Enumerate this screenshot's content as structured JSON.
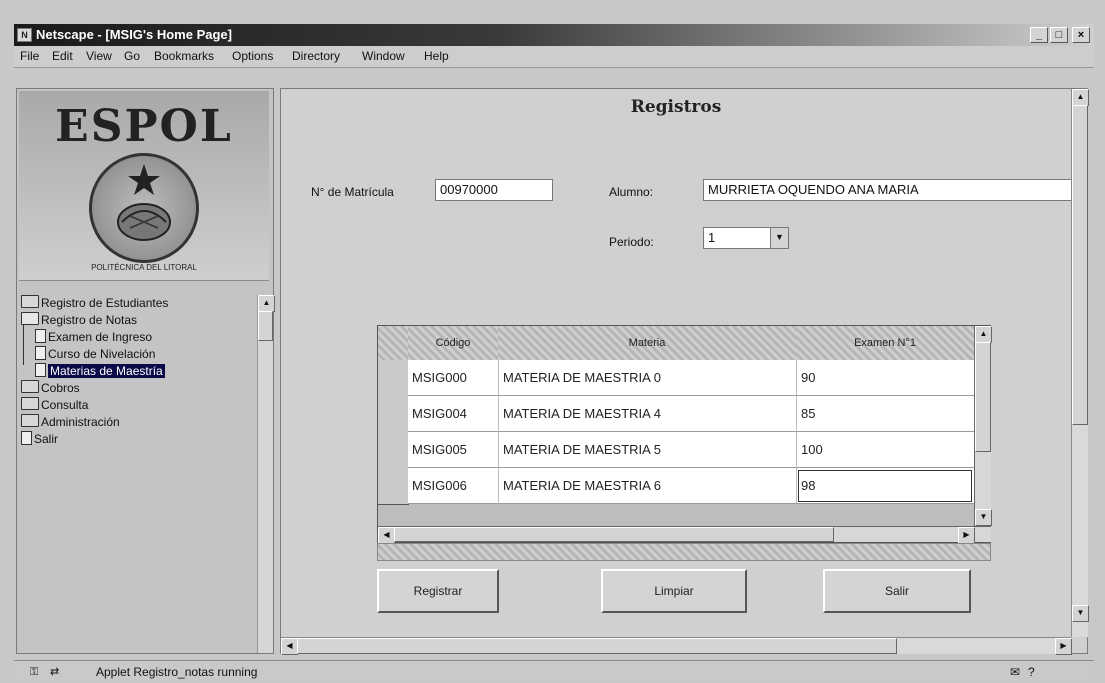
{
  "window": {
    "title": "Netscape - [MSIG's Home Page]",
    "controls": [
      "_",
      "□",
      "×"
    ]
  },
  "menu": [
    "File",
    "Edit",
    "View",
    "Go",
    "Bookmarks",
    "Options",
    "Directory",
    "Window",
    "Help"
  ],
  "logo": {
    "text": "ESPOL",
    "caption": "POLITÉCNICA DEL LITORAL"
  },
  "tree": [
    {
      "label": "Registro de Estudiantes",
      "type": "folder",
      "level": 0
    },
    {
      "label": "Registro de Notas",
      "type": "folder-open",
      "level": 0
    },
    {
      "label": "Examen de Ingreso",
      "type": "doc",
      "level": 1
    },
    {
      "label": "Curso de Nivelación",
      "type": "doc",
      "level": 1
    },
    {
      "label": "Materias de Maestría",
      "type": "doc",
      "level": 1,
      "selected": true
    },
    {
      "label": "Cobros",
      "type": "folder",
      "level": 0
    },
    {
      "label": "Consulta",
      "type": "folder",
      "level": 0
    },
    {
      "label": "Administración",
      "type": "folder",
      "level": 0
    },
    {
      "label": "Salir",
      "type": "doc",
      "level": 0
    }
  ],
  "page": {
    "title": "Registros",
    "matricula_label": "N° de Matrícula",
    "matricula_value": "00970000",
    "alumno_label": "Alumno:",
    "alumno_value": "MURRIETA OQUENDO ANA MARIA",
    "periodo_label": "Periodo:",
    "periodo_value": "1"
  },
  "table": {
    "columns": [
      "Código",
      "Materia",
      "Examen N°1"
    ],
    "rows": [
      {
        "codigo": "MSIG000",
        "materia": "MATERIA DE MAESTRIA 0",
        "nota": "90"
      },
      {
        "codigo": "MSIG004",
        "materia": "MATERIA DE MAESTRIA 4",
        "nota": "85"
      },
      {
        "codigo": "MSIG005",
        "materia": "MATERIA DE MAESTRIA 5",
        "nota": "100"
      },
      {
        "codigo": "MSIG006",
        "materia": "MATERIA DE MAESTRIA 6",
        "nota": "98"
      }
    ]
  },
  "buttons": {
    "registrar": "Registrar",
    "limpiar": "Limpiar",
    "salir": "Salir"
  },
  "status": {
    "text": "Applet Registro_notas running"
  }
}
